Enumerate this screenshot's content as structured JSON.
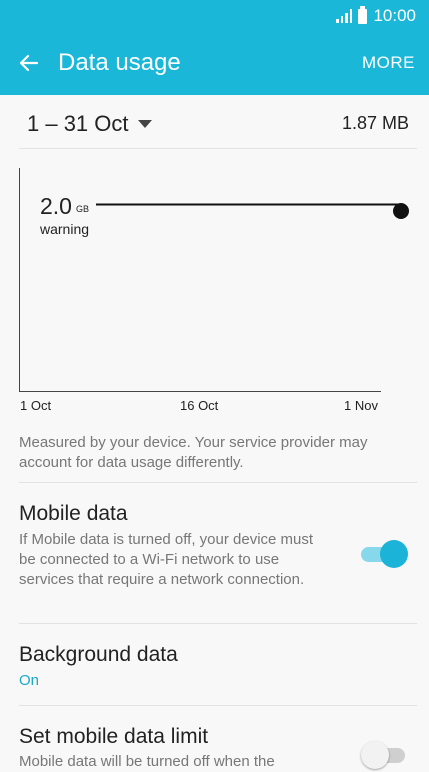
{
  "status_bar": {
    "time": "10:00",
    "icons": [
      "signal-icon",
      "battery-icon"
    ]
  },
  "app_bar": {
    "title": "Data usage",
    "more_label": "MORE",
    "back_icon": "back-arrow-icon"
  },
  "cycle": {
    "range": "1 – 31 Oct",
    "total": "1.87 MB"
  },
  "chart_data": {
    "type": "line",
    "x_ticks": [
      "1 Oct",
      "16 Oct",
      "1 Nov"
    ],
    "warning": {
      "value": "2.0",
      "unit": "GB",
      "label": "warning"
    }
  },
  "note": "Measured by your device. Your service provider may account for data usage differently.",
  "settings": {
    "mobile_data": {
      "title": "Mobile data",
      "description": "If Mobile data is turned off, your device must be connected to a Wi-Fi network to use services that require a network connection.",
      "enabled": true
    },
    "background_data": {
      "title": "Background data",
      "value": "On"
    },
    "data_limit": {
      "title": "Set mobile data limit",
      "description": "Mobile data will be turned off when the",
      "enabled": false
    }
  },
  "colors": {
    "accent": "#1bb7d9",
    "link": "#1aa8cc"
  }
}
